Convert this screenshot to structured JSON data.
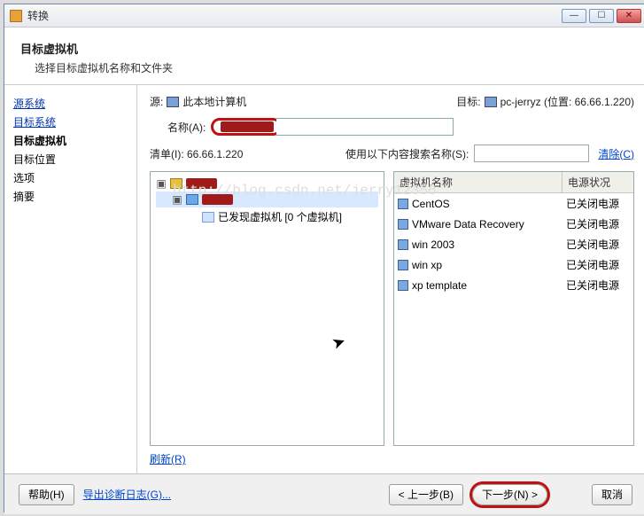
{
  "window": {
    "title": "转换"
  },
  "header": {
    "title": "目标虚拟机",
    "subtitle": "选择目标虚拟机名称和文件夹"
  },
  "sidebar": {
    "items": [
      {
        "label": "源系统",
        "kind": "link"
      },
      {
        "label": "目标系统",
        "kind": "link"
      },
      {
        "label": "目标虚拟机",
        "kind": "current"
      },
      {
        "label": "目标位置",
        "kind": "plain"
      },
      {
        "label": "选项",
        "kind": "plain"
      },
      {
        "label": "摘要",
        "kind": "plain"
      }
    ]
  },
  "main": {
    "source_label": "源:",
    "source_value": "此本地计算机",
    "dest_label": "目标:",
    "dest_value": "pc-jerryz (位置: 66.66.1.220)",
    "name_label": "名称(A):",
    "name_value": "",
    "list_label": "清单(I): 66.66.1.220",
    "search_label": "使用以下内容搜索名称(S):",
    "search_value": "",
    "clear_label": "清除(C)",
    "refresh_label": "刷新(R)",
    "tree": {
      "row0_label": "",
      "row1_label": "",
      "row2_label": "已发现虚拟机 [0 个虚拟机]"
    },
    "vm_table": {
      "col_name": "虚拟机名称",
      "col_power": "电源状况",
      "rows": [
        {
          "name": "CentOS",
          "power": "已关闭电源"
        },
        {
          "name": "VMware Data Recovery",
          "power": "已关闭电源"
        },
        {
          "name": "win 2003",
          "power": "已关闭电源"
        },
        {
          "name": "win xp",
          "power": "已关闭电源"
        },
        {
          "name": "xp template",
          "power": "已关闭电源"
        }
      ]
    }
  },
  "footer": {
    "help_label": "帮助(H)",
    "export_label": "导出诊断日志(G)...",
    "back_label": "< 上一步(B)",
    "next_label": "下一步(N) >",
    "cancel_label": "取消"
  },
  "watermark": "http://blog.csdn.net/jerry12356"
}
